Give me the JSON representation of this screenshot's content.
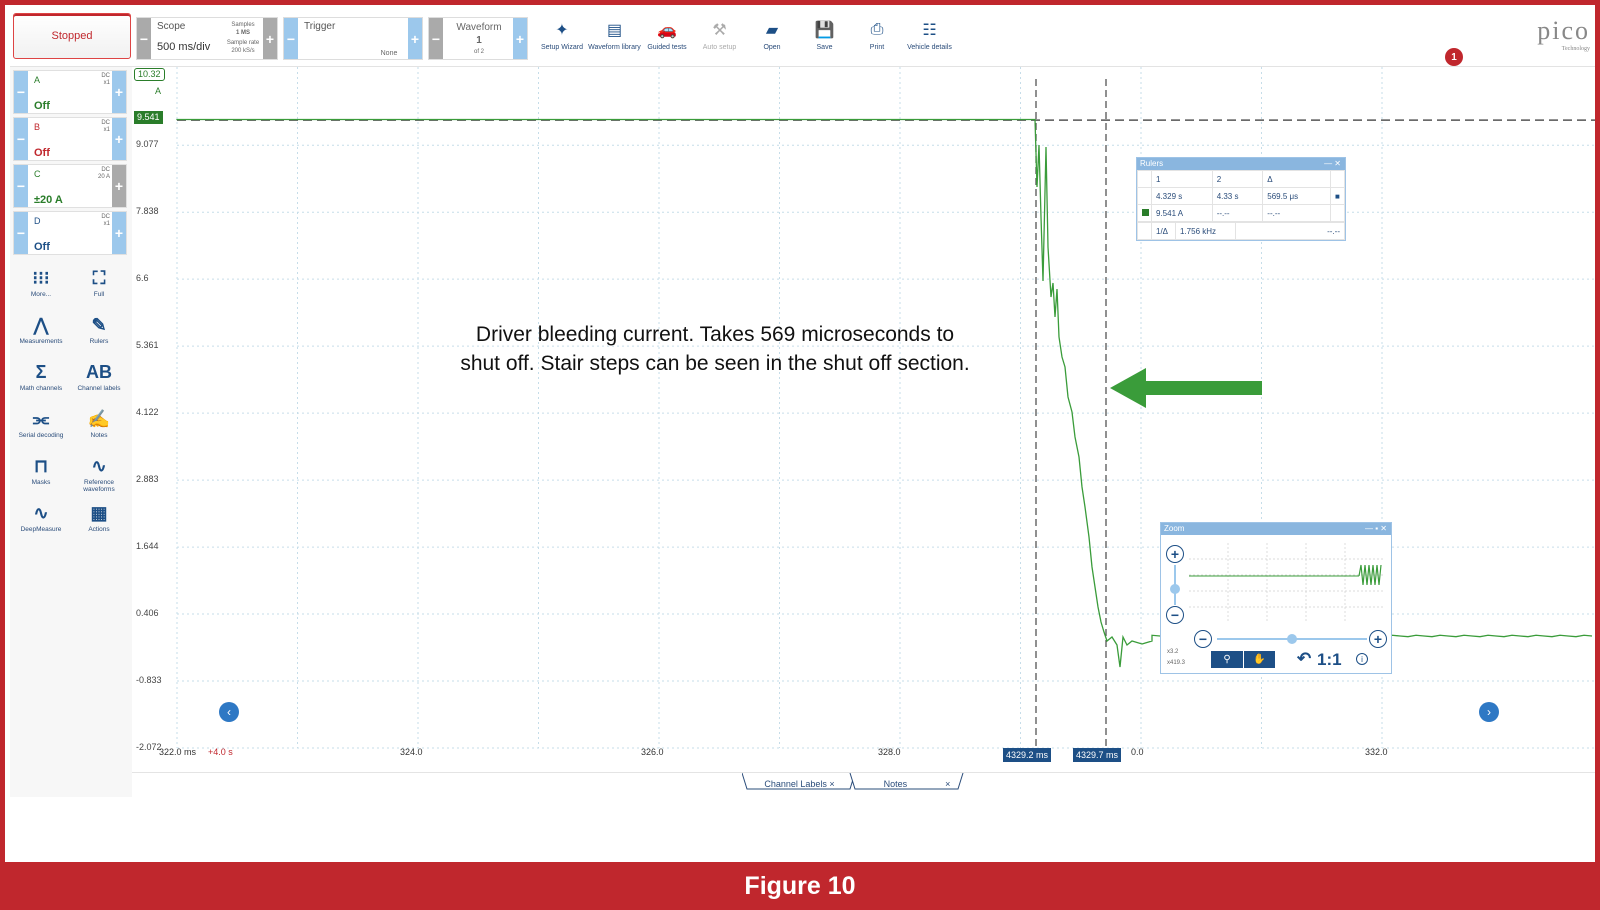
{
  "toolbar": {
    "run_state": "Stopped",
    "scope": {
      "label": "Scope",
      "value": "500 ms/div",
      "samples_label": "Samples",
      "samples_value": "1 MS",
      "rate_label": "Sample rate",
      "rate_value": "200 kS/s"
    },
    "trigger": {
      "label": "Trigger",
      "mode": "None"
    },
    "waveform": {
      "label": "Waveform",
      "value": "1",
      "of": "of 2"
    },
    "tools": [
      {
        "label": "Setup Wizard",
        "icon": "wizard-icon",
        "enabled": true
      },
      {
        "label": "Waveform library",
        "icon": "library-icon",
        "enabled": true
      },
      {
        "label": "Guided tests",
        "icon": "car-icon",
        "enabled": true
      },
      {
        "label": "Auto setup",
        "icon": "wand-icon",
        "enabled": false
      },
      {
        "label": "Open",
        "icon": "folder-icon",
        "enabled": true
      },
      {
        "label": "Save",
        "icon": "save-icon",
        "enabled": true
      },
      {
        "label": "Print",
        "icon": "printer-icon",
        "enabled": true
      },
      {
        "label": "Vehicle details",
        "icon": "clipboard-icon",
        "enabled": true
      }
    ],
    "logo": "pico",
    "logo_sub": "Technology",
    "notification_count": "1"
  },
  "channels": [
    {
      "name": "A",
      "coupling": "DC",
      "range": "x1",
      "state": "Off",
      "color": "#2a7d2a"
    },
    {
      "name": "B",
      "coupling": "DC",
      "range": "x1",
      "state": "Off",
      "color": "#c0272d"
    },
    {
      "name": "C",
      "coupling": "DC",
      "range": "20 A",
      "state": "±20 A",
      "color": "#2a7d2a"
    },
    {
      "name": "D",
      "coupling": "DC",
      "range": "x1",
      "state": "Off",
      "color": "#1d4f86"
    }
  ],
  "side_tools": [
    {
      "label": "More...",
      "icon": "grid-icon"
    },
    {
      "label": "Full",
      "icon": "fullscreen-icon"
    },
    {
      "label": "Measurements",
      "icon": "compass-icon"
    },
    {
      "label": "Rulers",
      "icon": "ruler-icon"
    },
    {
      "label": "Math channels",
      "icon": "sigma-icon"
    },
    {
      "label": "Channel labels",
      "icon": "abcd-icon"
    },
    {
      "label": "Serial decoding",
      "icon": "serial-icon"
    },
    {
      "label": "Notes",
      "icon": "notes-icon"
    },
    {
      "label": "Masks",
      "icon": "mask-icon"
    },
    {
      "label": "Reference waveforms",
      "icon": "reference-icon"
    },
    {
      "label": "DeepMeasure",
      "icon": "deepmeasure-icon"
    },
    {
      "label": "Actions",
      "icon": "actions-icon"
    }
  ],
  "plot": {
    "y_ticks": [
      "9.077",
      "7.838",
      "6.6",
      "5.361",
      "4.122",
      "2.883",
      "1.644",
      "0.406",
      "-0.833",
      "-2.072"
    ],
    "y_top_marker": "10.32",
    "y_unit": "A",
    "level_marker": "9.541",
    "x_ticks": [
      "322.0 ms",
      "324.0",
      "326.0",
      "328.0",
      "0.0",
      "332.0"
    ],
    "x_offset": "+4.0 s",
    "ruler1_label": "4329.2 ms",
    "ruler2_label": "4329.7 ms"
  },
  "rulers_panel": {
    "title": "Rulers",
    "col1": "1",
    "col2": "2",
    "col3": "Δ",
    "time1": "4.329 s",
    "time2": "4.33 s",
    "time_delta": "569.5 μs",
    "val1": "9.541 A",
    "val2": "--.--",
    "val_delta": "--.--",
    "freq_label": "1/Δ",
    "freq_value": "1.756 kHz",
    "freq_other": "--.--"
  },
  "zoom_panel": {
    "title": "Zoom",
    "x_zoom": "x3.2",
    "y_zoom": "x419.3",
    "ratio": "1:1"
  },
  "annotation": "Driver bleeding current. Takes 569 microseconds to shut off. Stair steps can be seen in the shut off section.",
  "bottom_tabs": [
    {
      "label": "Channel Labels"
    },
    {
      "label": "Notes"
    }
  ],
  "caption": "Figure 10",
  "colors": {
    "trace": "#3a9c3a",
    "accent": "#1d4f86",
    "caption_bg": "#c0272d"
  }
}
